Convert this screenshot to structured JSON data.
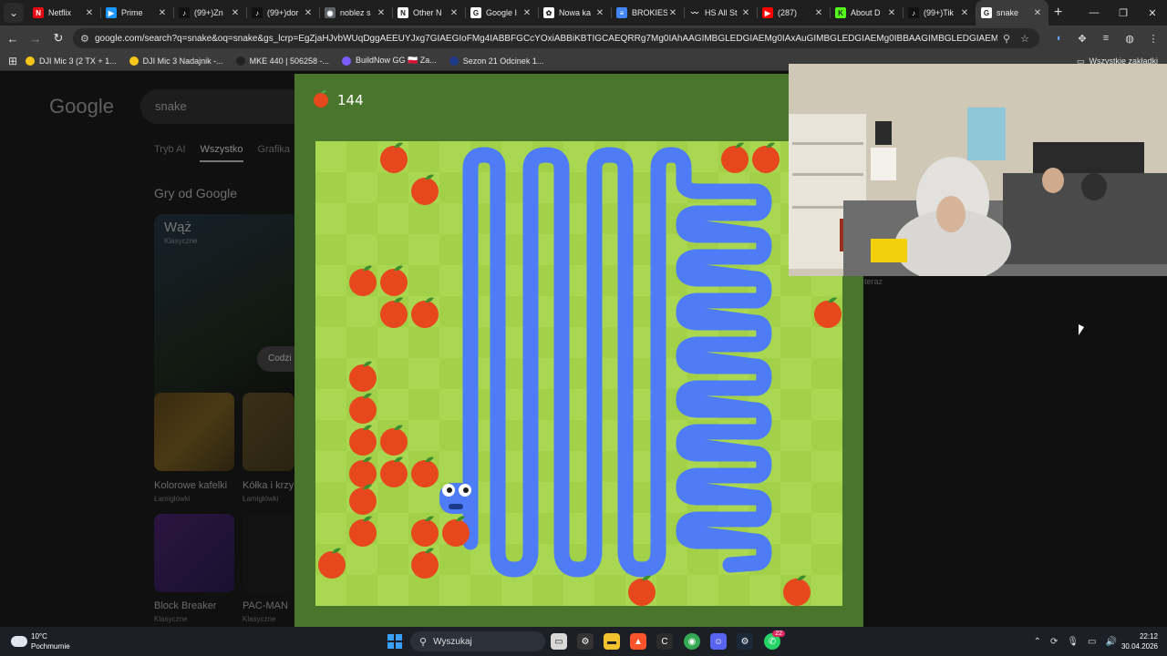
{
  "browser": {
    "tabs": [
      {
        "label": "Netflix",
        "icon": "netflix-icon",
        "color": "#e50914",
        "glyph": "N"
      },
      {
        "label": "Prime",
        "icon": "prime-icon",
        "color": "#1a98ff",
        "glyph": "▶"
      },
      {
        "label": "(99+)Zn",
        "icon": "tiktok-icon",
        "color": "#111111",
        "glyph": "♪"
      },
      {
        "label": "(99+)dor",
        "icon": "tiktok-icon",
        "color": "#111111",
        "glyph": "♪"
      },
      {
        "label": "noblez s",
        "icon": "globe-icon",
        "color": "#5f6368",
        "glyph": "◉"
      },
      {
        "label": "Other N",
        "icon": "notion-icon",
        "color": "#ffffff",
        "glyph": "N"
      },
      {
        "label": "Google I",
        "icon": "google-icon",
        "color": "#ffffff",
        "glyph": "G"
      },
      {
        "label": "Nowa ka",
        "icon": "openai-icon",
        "color": "#ffffff",
        "glyph": "✿"
      },
      {
        "label": "BROKIES",
        "icon": "docs-icon",
        "color": "#4285f4",
        "glyph": "≡"
      },
      {
        "label": "HS All St",
        "icon": "hs-icon",
        "color": "#1f1f1f",
        "glyph": "〰"
      },
      {
        "label": "(287)",
        "icon": "youtube-icon",
        "color": "#ff0000",
        "glyph": "▶"
      },
      {
        "label": "About D",
        "icon": "kick-icon",
        "color": "#53fc18",
        "glyph": "K"
      },
      {
        "label": "(99+)Tik",
        "icon": "tiktok-icon",
        "color": "#111111",
        "glyph": "♪"
      },
      {
        "label": "snake",
        "icon": "google-icon",
        "color": "#ffffff",
        "glyph": "G",
        "active": true
      }
    ],
    "url": "google.com/search?q=snake&oq=snake&gs_lcrp=EgZjaHJvbWUqDggAEEUYJxg7GIAEGIoFMg4IABBFGCcYOxiABBiKBTIGCAEQRRg7Mg0IAhAAGIMBGLEDGIAEMg0IAxAuGIMBGLEDGIAEMg0IBBAAGIMBGLEDGIAEMgoIBRAAGLEDGIAEMgYIB...",
    "bookmarks": [
      {
        "label": "DJI Mic 3 (2 TX + 1...",
        "color": "#f5c518"
      },
      {
        "label": "DJI Mic 3 Nadajnik -...",
        "color": "#f5c518"
      },
      {
        "label": "MKE 440 | 506258 -...",
        "color": "#222222"
      },
      {
        "label": "BuildNow GG  🇵🇱  Za...",
        "color": "#7b5cff"
      },
      {
        "label": "Sezon 21 Odcinek 1...",
        "color": "#1e3a8a"
      }
    ],
    "all_bookmarks": "Wszystkie zakładki"
  },
  "google": {
    "logo": "Google",
    "query": "snake",
    "tabs": [
      "Tryb AI",
      "Wszystko",
      "Grafika"
    ],
    "games_heading": "Gry od Google",
    "hero_title": "Wąż",
    "hero_subtitle": "Klasyczne",
    "chip": "Codzi",
    "cards": [
      {
        "title": "Kolorowe kafelki",
        "subtitle": "Łamigłówki"
      },
      {
        "title": "Kółka i krzy",
        "subtitle": "Łamigłówki"
      },
      {
        "title": "Block Breaker",
        "subtitle": "Klasyczne"
      },
      {
        "title": "PAC-MAN",
        "subtitle": "Klasyczne"
      }
    ],
    "right_text": "teraz"
  },
  "game": {
    "score": "144",
    "colors": {
      "frame": "#4a752c",
      "light": "#aad751",
      "dark": "#a2d149",
      "snake": "#4e7cf6",
      "apple": "#e7471d"
    },
    "grid_cols": 17,
    "grid_rows": 15
  },
  "taskbar": {
    "temperature": "10°C",
    "condition": "Pochmurnie",
    "search_placeholder": "Wyszukaj",
    "time": "22:12",
    "date": "30.04.2026",
    "whatsapp_badge": "22"
  }
}
